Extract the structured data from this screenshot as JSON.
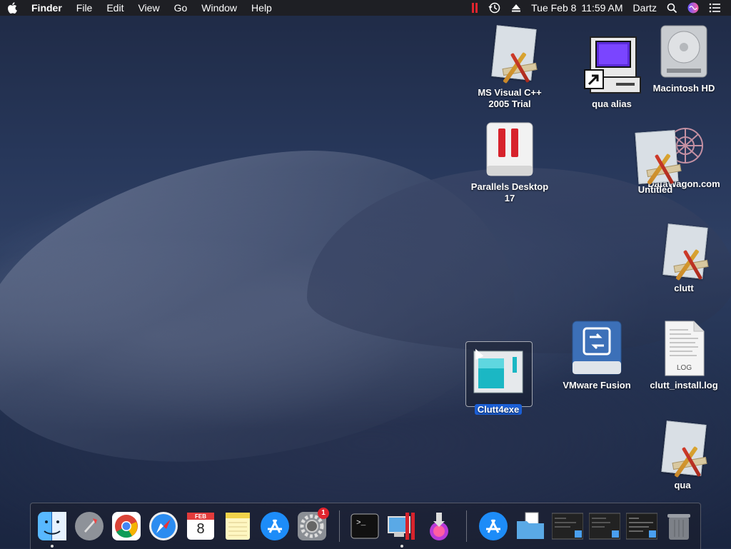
{
  "menubar": {
    "app_name": "Finder",
    "menus": [
      "File",
      "Edit",
      "View",
      "Go",
      "Window",
      "Help"
    ],
    "status": {
      "date": "Tue Feb 8",
      "time": "11:59 AM",
      "user": "Dartz"
    },
    "icons": [
      "apple-icon",
      "parallels-icon",
      "time-machine-icon",
      "eject-icon",
      "spotlight-icon",
      "siri-icon",
      "notification-center-icon"
    ]
  },
  "desktop": {
    "icons": [
      {
        "label": "MS Visual C++ 2005 Trial",
        "kind": "document"
      },
      {
        "label": "qua alias",
        "kind": "alias"
      },
      {
        "label": "Macintosh HD",
        "kind": "disk"
      },
      {
        "label": "Parallels Desktop 17",
        "kind": "app"
      },
      {
        "label": "Untitled",
        "kind": "document"
      },
      {
        "label": "DataWagon.com",
        "kind": "webloc"
      },
      {
        "label": "clutt",
        "kind": "document"
      },
      {
        "label": "Clutt4exe",
        "kind": "app",
        "selected": true
      },
      {
        "label": "VMware Fusion",
        "kind": "app"
      },
      {
        "label": "clutt_install.log",
        "kind": "log",
        "badge": "LOG"
      },
      {
        "label": "qua",
        "kind": "document"
      }
    ]
  },
  "dock": {
    "items": [
      "finder-icon",
      "launchpad-icon",
      "chrome-icon",
      "safari-icon",
      "calendar-icon",
      "notes-icon",
      "app-store-icon",
      "system-preferences-icon",
      "terminal-icon",
      "parallels-desktop-icon",
      "disk-utility-icon",
      "app-store-icon-2",
      "downloads-stack-icon",
      "window-thumb-1",
      "window-thumb-2",
      "window-thumb-3",
      "trash-icon"
    ],
    "calendar": {
      "month": "FEB",
      "day": "8"
    },
    "system_prefs_badge": "1",
    "terminal_prompt": ">_"
  },
  "colors": {
    "selection": "#1b5fd6",
    "menubar": "#1e1e22",
    "parallels_red": "#e0242e"
  }
}
